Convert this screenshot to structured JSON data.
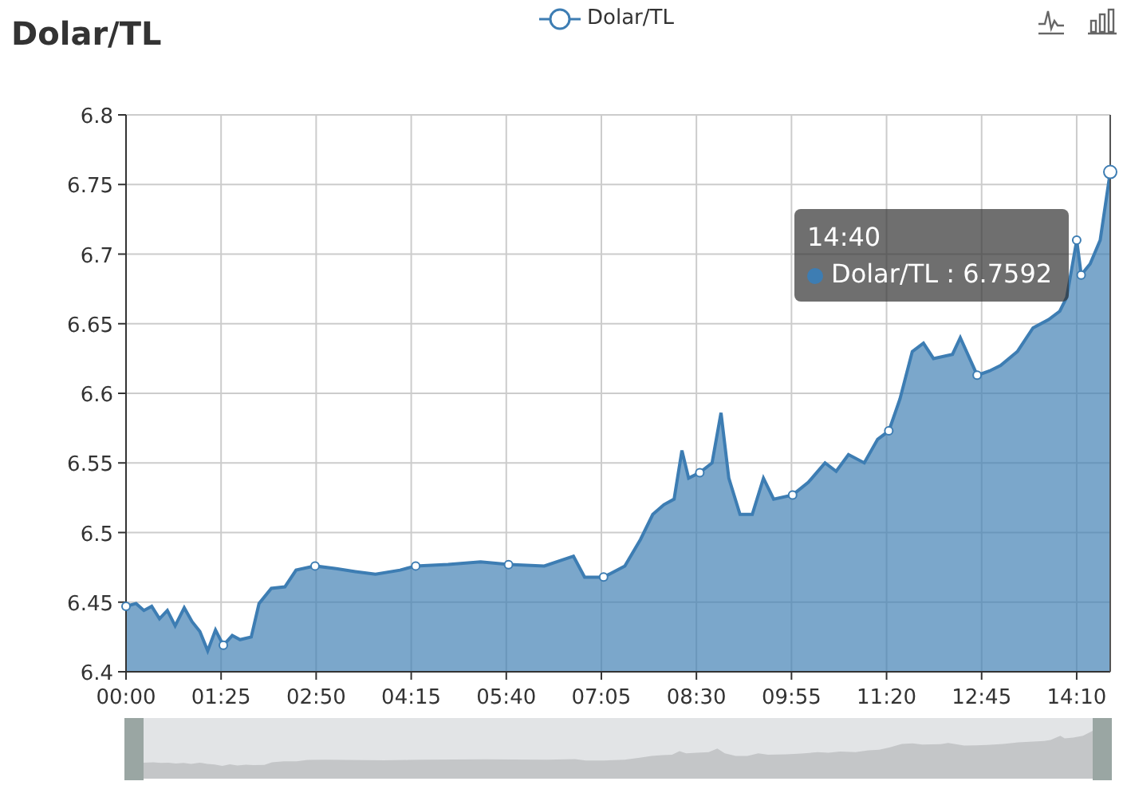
{
  "title": "Dolar/TL",
  "toolbox": [
    {
      "kind": "line"
    },
    {
      "kind": "bar"
    }
  ],
  "chart_data": {
    "type": "area",
    "grid": true,
    "xlim": [
      0,
      880
    ],
    "ylim": [
      6.4,
      6.8
    ],
    "x": [
      0,
      9,
      16,
      23,
      30,
      37,
      44,
      52,
      59,
      66,
      73,
      80,
      87,
      95,
      102,
      112,
      119,
      130,
      142,
      152,
      169,
      188,
      205,
      223,
      245,
      259,
      288,
      317,
      342,
      374,
      400,
      410,
      427,
      446,
      460,
      471,
      481,
      490,
      497,
      503,
      513,
      524,
      532,
      539,
      549,
      560,
      570,
      579,
      596,
      610,
      625,
      635,
      646,
      660,
      672,
      682,
      692,
      703,
      713,
      722,
      739,
      746,
      761,
      772,
      782,
      797,
      811,
      825,
      835,
      841,
      850,
      854,
      862,
      871,
      880
    ],
    "series": [
      {
        "name": "Dolar/TL",
        "color": "#3d7db3",
        "values": [
          6.447,
          6.449,
          6.444,
          6.447,
          6.438,
          6.444,
          6.433,
          6.446,
          6.436,
          6.429,
          6.415,
          6.43,
          6.419,
          6.426,
          6.423,
          6.425,
          6.449,
          6.46,
          6.461,
          6.473,
          6.476,
          6.474,
          6.472,
          6.47,
          6.473,
          6.476,
          6.477,
          6.479,
          6.477,
          6.476,
          6.483,
          6.468,
          6.468,
          6.476,
          6.495,
          6.513,
          6.52,
          6.524,
          6.559,
          6.539,
          6.543,
          6.55,
          6.586,
          6.539,
          6.513,
          6.513,
          6.539,
          6.524,
          6.527,
          6.536,
          6.55,
          6.544,
          6.556,
          6.55,
          6.567,
          6.573,
          6.596,
          6.63,
          6.636,
          6.625,
          6.628,
          6.64,
          6.613,
          6.616,
          6.62,
          6.63,
          6.647,
          6.653,
          6.659,
          6.669,
          6.71,
          6.685,
          6.693,
          6.71,
          6.759
        ]
      }
    ],
    "xticks": [
      {
        "value": 0,
        "label": "00:00"
      },
      {
        "value": 85,
        "label": "01:25"
      },
      {
        "value": 170,
        "label": "02:50"
      },
      {
        "value": 255,
        "label": "04:15"
      },
      {
        "value": 340,
        "label": "05:40"
      },
      {
        "value": 425,
        "label": "07:05"
      },
      {
        "value": 510,
        "label": "08:30"
      },
      {
        "value": 595,
        "label": "09:55"
      },
      {
        "value": 680,
        "label": "11:20"
      },
      {
        "value": 765,
        "label": "12:45"
      },
      {
        "value": 850,
        "label": "14:10"
      }
    ],
    "yticks": [
      6.4,
      6.45,
      6.5,
      6.55,
      6.6,
      6.65,
      6.7,
      6.75,
      6.8
    ]
  },
  "tooltip": {
    "time": "14:40",
    "text": "Dolar/TL : 6.7592"
  }
}
